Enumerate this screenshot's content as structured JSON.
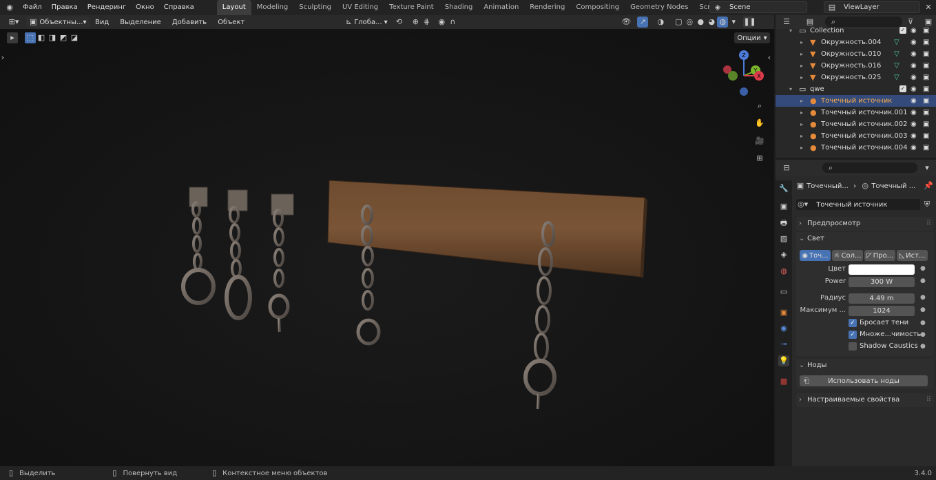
{
  "topbar": {
    "menu": [
      "Файл",
      "Правка",
      "Рендеринг",
      "Окно",
      "Справка"
    ],
    "workspaces": [
      "Layout",
      "Modeling",
      "Sculpting",
      "UV Editing",
      "Texture Paint",
      "Shading",
      "Animation",
      "Rendering",
      "Compositing",
      "Geometry Nodes",
      "Scripting"
    ],
    "active_workspace": "Layout",
    "scene": "Scene",
    "view_layer": "ViewLayer"
  },
  "viewport_header": {
    "mode": "Объектны...",
    "menu": [
      "Вид",
      "Выделение",
      "Добавить",
      "Объект"
    ],
    "orientation": "Глоба...",
    "options": "Опции"
  },
  "gizmo": {
    "z": "Z",
    "y": "Y",
    "x": "X"
  },
  "outliner": {
    "rows": [
      {
        "name": "Collection",
        "type": "collection",
        "indent": 1
      },
      {
        "name": "Окружность.004",
        "type": "mesh",
        "indent": 2
      },
      {
        "name": "Окружность.010",
        "type": "mesh",
        "indent": 2
      },
      {
        "name": "Окружность.016",
        "type": "mesh",
        "indent": 2
      },
      {
        "name": "Окружность.025",
        "type": "mesh",
        "indent": 2
      },
      {
        "name": "qwe",
        "type": "collection",
        "indent": 1
      },
      {
        "name": "Точечный источник",
        "type": "light",
        "indent": 2,
        "selected": true
      },
      {
        "name": "Точечный источник.001",
        "type": "light",
        "indent": 2
      },
      {
        "name": "Точечный источник.002",
        "type": "light",
        "indent": 2
      },
      {
        "name": "Точечный источник.003",
        "type": "light",
        "indent": 2
      },
      {
        "name": "Точечный источник.004",
        "type": "light",
        "indent": 2
      }
    ]
  },
  "properties": {
    "breadcrumb": [
      "Точечный...",
      "Точечный ..."
    ],
    "datablock": "Точечный источник",
    "preview_panel": "Предпросмотр",
    "light_panel": "Свет",
    "light_types": [
      "Точ...",
      "Сол...",
      "Про...",
      "Ист..."
    ],
    "color_label": "Цвет",
    "power_label": "Power",
    "power_value": "300 W",
    "radius_label": "Радиус",
    "radius_value": "4.49 m",
    "max_label": "Максимум ...",
    "max_value": "1024",
    "cast_shadow": "Бросает тени",
    "multi_importance": "Множе...чимость",
    "shadow_caustics": "Shadow Caustics",
    "nodes_panel": "Ноды",
    "use_nodes": "Использовать ноды",
    "custom_props": "Настраиваемые свойства"
  },
  "statusbar": {
    "select": "Выделить",
    "rotate": "Повернуть вид",
    "context": "Контекстное меню объектов",
    "version": "3.4.0"
  },
  "colors": {
    "accent": "#4772b3",
    "selected_row": "#334a7a",
    "light_icon": "#e5893b"
  }
}
